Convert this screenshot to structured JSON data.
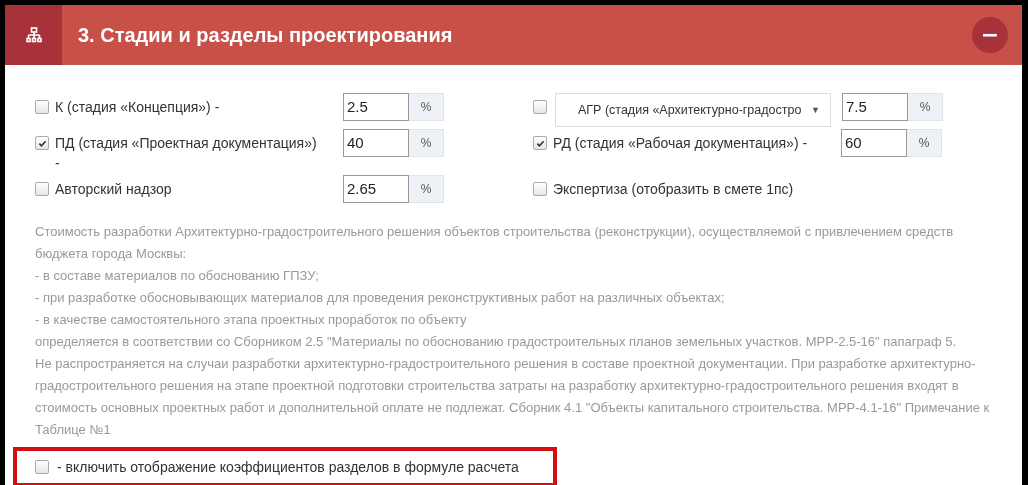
{
  "header": {
    "title": "3. Стадии и разделы проектирования",
    "collapse_button": "−"
  },
  "options": [
    {
      "kind": "checkbox",
      "checked": false,
      "label": "К (стадия «Концепция») -",
      "value": "2.5",
      "unit": "%"
    },
    {
      "kind": "select",
      "checked": false,
      "selected_option": "АГР (стадия «Архитектурно-градостро",
      "caret": "▼",
      "value": "7.5",
      "unit": "%"
    },
    {
      "kind": "checkbox",
      "checked": true,
      "label": "ПД (стадия «Проектная документация»)\n-",
      "value": "40",
      "unit": "%"
    },
    {
      "kind": "checkbox",
      "checked": true,
      "label": "РД (стадия «Рабочая документация») -",
      "value": "60",
      "unit": "%"
    },
    {
      "kind": "checkbox",
      "checked": false,
      "label": "Авторский надзор",
      "value": "2.65",
      "unit": "%"
    },
    {
      "kind": "label_only",
      "checked": false,
      "label": "Экспертиза (отобразить в смете 1пс)"
    }
  ],
  "description": [
    "Стоимость разработки Архитектурно-градостроительного решения объектов строительства (реконструкции), осуществляемой с привлечением средств бюджета города Москвы:",
    "- в составе материалов по обоснованию ГПЗУ;",
    "- при разработке обосновывающих материалов для проведения реконструктивных работ на различных объектах;",
    "- в качестве самостоятельного этапа проектных проработок по объекту",
    "определяется в соответствии со Сборником 2.5 \"Материалы по обоснованию градостроительных планов земельных участков. МРР-2.5-16\" папаграф 5.",
    "Не распространяется на случаи разработки архитектурно-градостроительного решения в составе проектной документации. При разработке архитектурно-градостроительного решения на этапе проектной подготовки строительства затраты на разработку архитектурно-градостроительного решения входят в стоимость основных проектных работ и дополнительной оплате не подлежат. Сборник 4.1 \"Объекты капитального строительства. МРР-4.1-16\" Примечание к Таблице №1"
  ],
  "coefficients_toggle": {
    "checked": false,
    "label": "- включить отображение коэффициентов разделов в формуле расчета",
    "highlighted": true
  }
}
